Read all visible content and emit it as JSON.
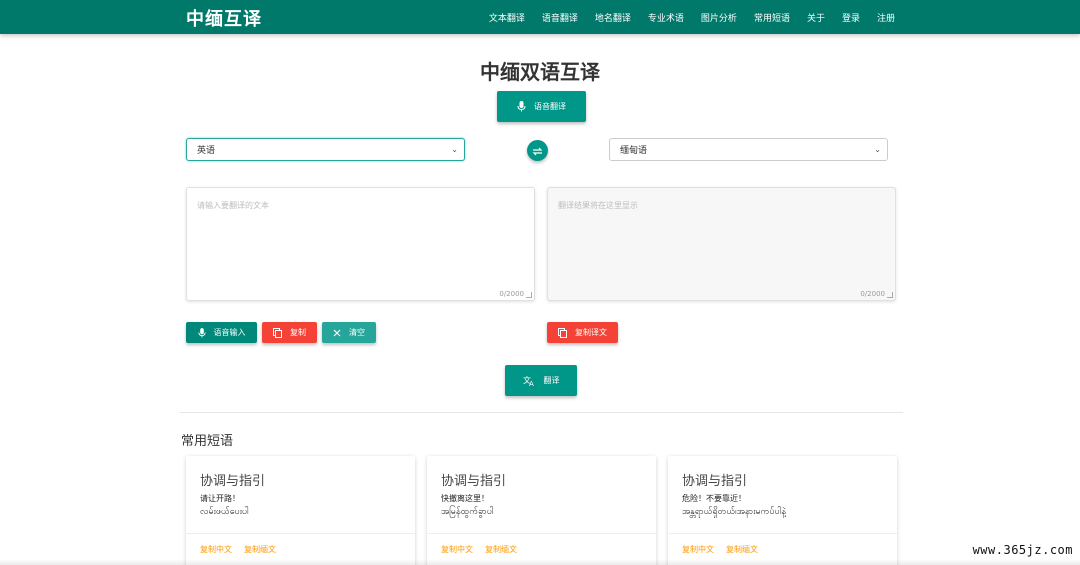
{
  "header": {
    "brand": "中缅互译",
    "nav": [
      "文本翻译",
      "语音翻译",
      "地名翻译",
      "专业术语",
      "图片分析",
      "常用短语",
      "关于",
      "登录",
      "注册"
    ]
  },
  "main": {
    "title": "中缅双语互译",
    "voice_translate_label": "语音翻译",
    "source_lang": "英语",
    "target_lang": "缅甸语",
    "source_placeholder": "请输入要翻译的文本",
    "target_placeholder": "翻译结果将在这里显示",
    "source_counter": "0/2000",
    "target_counter": "0/2000",
    "voice_input_label": "语音输入",
    "copy_label": "复制",
    "clear_label": "清空",
    "copy_translation_label": "复制译文",
    "translate_label": "翻译"
  },
  "phrases": {
    "title": "常用短语",
    "cards": [
      {
        "title": "协调与指引",
        "zh": "请让开路！",
        "my": "လမ်းဖယ်ပေးပါ",
        "copy_zh": "复制中文",
        "copy_my": "复制缅文"
      },
      {
        "title": "协调与指引",
        "zh": "快撤离这里！",
        "my": "အမြန်ထွက်ခွာပါ",
        "copy_zh": "复制中文",
        "copy_my": "复制缅文"
      },
      {
        "title": "协调与指引",
        "zh": "危险！不要靠近！",
        "my": "အန္တရာယ်ရှိတယ်၊အနားမကပ်ပါနဲ့",
        "copy_zh": "复制中文",
        "copy_my": "复制缅文"
      }
    ]
  },
  "watermark": "www.365jz.com",
  "colors": {
    "primary": "#00796b",
    "accent": "#009688",
    "danger": "#f44336",
    "link": "#ff9800"
  },
  "icons": [
    "mic-icon",
    "swap-icon",
    "copy-icon",
    "close-icon",
    "translate-icon"
  ]
}
